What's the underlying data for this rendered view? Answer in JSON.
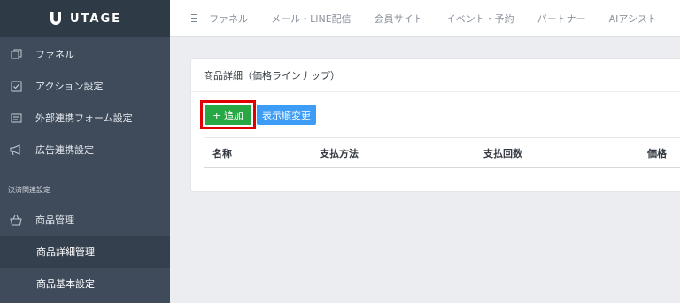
{
  "app": {
    "logo_text": "UTAGE",
    "logo_icon": "utage-logo-icon"
  },
  "topnav": {
    "menu_icon": "hamburger-icon",
    "items": [
      "ファネル",
      "メール・LINE配信",
      "会員サイト",
      "イベント・予約",
      "パートナー",
      "AIアシスト"
    ]
  },
  "sidebar": {
    "items": [
      {
        "label": "ファネル",
        "icon": "funnel-icon"
      },
      {
        "label": "アクション設定",
        "icon": "check-square-icon"
      },
      {
        "label": "外部連携フォーム設定",
        "icon": "form-icon"
      },
      {
        "label": "広告連携設定",
        "icon": "megaphone-icon"
      }
    ],
    "section_label": "決済関連設定",
    "product_menu": {
      "label": "商品管理",
      "icon": "basket-icon"
    },
    "sub_items": [
      {
        "label": "商品詳細管理",
        "active": true
      },
      {
        "label": "商品基本設定",
        "active": false
      }
    ]
  },
  "main": {
    "card_title": "商品詳細（価格ラインナップ）",
    "add_button": "+ 追加",
    "sort_button": "表示順変更",
    "table": {
      "columns": [
        "名称",
        "支払方法",
        "支払回数",
        "価格"
      ]
    }
  },
  "colors": {
    "sidebar_bg": "#3f4b5b",
    "add_button": "#28a745",
    "sort_button": "#3d9cf5",
    "highlight": "#e00000"
  }
}
